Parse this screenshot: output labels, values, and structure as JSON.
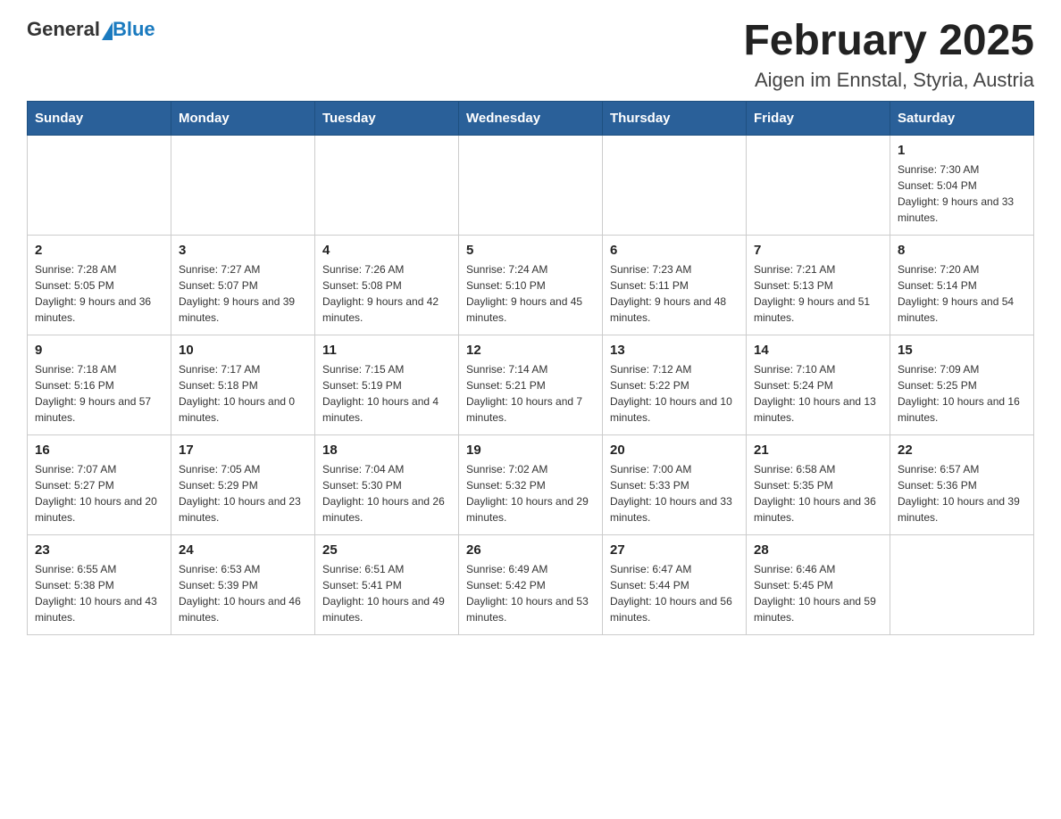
{
  "header": {
    "logo_general": "General",
    "logo_blue": "Blue",
    "title": "February 2025",
    "subtitle": "Aigen im Ennstal, Styria, Austria"
  },
  "days_of_week": [
    "Sunday",
    "Monday",
    "Tuesday",
    "Wednesday",
    "Thursday",
    "Friday",
    "Saturday"
  ],
  "weeks": [
    [
      {
        "day": "",
        "sunrise": "",
        "sunset": "",
        "daylight": ""
      },
      {
        "day": "",
        "sunrise": "",
        "sunset": "",
        "daylight": ""
      },
      {
        "day": "",
        "sunrise": "",
        "sunset": "",
        "daylight": ""
      },
      {
        "day": "",
        "sunrise": "",
        "sunset": "",
        "daylight": ""
      },
      {
        "day": "",
        "sunrise": "",
        "sunset": "",
        "daylight": ""
      },
      {
        "day": "",
        "sunrise": "",
        "sunset": "",
        "daylight": ""
      },
      {
        "day": "1",
        "sunrise": "Sunrise: 7:30 AM",
        "sunset": "Sunset: 5:04 PM",
        "daylight": "Daylight: 9 hours and 33 minutes."
      }
    ],
    [
      {
        "day": "2",
        "sunrise": "Sunrise: 7:28 AM",
        "sunset": "Sunset: 5:05 PM",
        "daylight": "Daylight: 9 hours and 36 minutes."
      },
      {
        "day": "3",
        "sunrise": "Sunrise: 7:27 AM",
        "sunset": "Sunset: 5:07 PM",
        "daylight": "Daylight: 9 hours and 39 minutes."
      },
      {
        "day": "4",
        "sunrise": "Sunrise: 7:26 AM",
        "sunset": "Sunset: 5:08 PM",
        "daylight": "Daylight: 9 hours and 42 minutes."
      },
      {
        "day": "5",
        "sunrise": "Sunrise: 7:24 AM",
        "sunset": "Sunset: 5:10 PM",
        "daylight": "Daylight: 9 hours and 45 minutes."
      },
      {
        "day": "6",
        "sunrise": "Sunrise: 7:23 AM",
        "sunset": "Sunset: 5:11 PM",
        "daylight": "Daylight: 9 hours and 48 minutes."
      },
      {
        "day": "7",
        "sunrise": "Sunrise: 7:21 AM",
        "sunset": "Sunset: 5:13 PM",
        "daylight": "Daylight: 9 hours and 51 minutes."
      },
      {
        "day": "8",
        "sunrise": "Sunrise: 7:20 AM",
        "sunset": "Sunset: 5:14 PM",
        "daylight": "Daylight: 9 hours and 54 minutes."
      }
    ],
    [
      {
        "day": "9",
        "sunrise": "Sunrise: 7:18 AM",
        "sunset": "Sunset: 5:16 PM",
        "daylight": "Daylight: 9 hours and 57 minutes."
      },
      {
        "day": "10",
        "sunrise": "Sunrise: 7:17 AM",
        "sunset": "Sunset: 5:18 PM",
        "daylight": "Daylight: 10 hours and 0 minutes."
      },
      {
        "day": "11",
        "sunrise": "Sunrise: 7:15 AM",
        "sunset": "Sunset: 5:19 PM",
        "daylight": "Daylight: 10 hours and 4 minutes."
      },
      {
        "day": "12",
        "sunrise": "Sunrise: 7:14 AM",
        "sunset": "Sunset: 5:21 PM",
        "daylight": "Daylight: 10 hours and 7 minutes."
      },
      {
        "day": "13",
        "sunrise": "Sunrise: 7:12 AM",
        "sunset": "Sunset: 5:22 PM",
        "daylight": "Daylight: 10 hours and 10 minutes."
      },
      {
        "day": "14",
        "sunrise": "Sunrise: 7:10 AM",
        "sunset": "Sunset: 5:24 PM",
        "daylight": "Daylight: 10 hours and 13 minutes."
      },
      {
        "day": "15",
        "sunrise": "Sunrise: 7:09 AM",
        "sunset": "Sunset: 5:25 PM",
        "daylight": "Daylight: 10 hours and 16 minutes."
      }
    ],
    [
      {
        "day": "16",
        "sunrise": "Sunrise: 7:07 AM",
        "sunset": "Sunset: 5:27 PM",
        "daylight": "Daylight: 10 hours and 20 minutes."
      },
      {
        "day": "17",
        "sunrise": "Sunrise: 7:05 AM",
        "sunset": "Sunset: 5:29 PM",
        "daylight": "Daylight: 10 hours and 23 minutes."
      },
      {
        "day": "18",
        "sunrise": "Sunrise: 7:04 AM",
        "sunset": "Sunset: 5:30 PM",
        "daylight": "Daylight: 10 hours and 26 minutes."
      },
      {
        "day": "19",
        "sunrise": "Sunrise: 7:02 AM",
        "sunset": "Sunset: 5:32 PM",
        "daylight": "Daylight: 10 hours and 29 minutes."
      },
      {
        "day": "20",
        "sunrise": "Sunrise: 7:00 AM",
        "sunset": "Sunset: 5:33 PM",
        "daylight": "Daylight: 10 hours and 33 minutes."
      },
      {
        "day": "21",
        "sunrise": "Sunrise: 6:58 AM",
        "sunset": "Sunset: 5:35 PM",
        "daylight": "Daylight: 10 hours and 36 minutes."
      },
      {
        "day": "22",
        "sunrise": "Sunrise: 6:57 AM",
        "sunset": "Sunset: 5:36 PM",
        "daylight": "Daylight: 10 hours and 39 minutes."
      }
    ],
    [
      {
        "day": "23",
        "sunrise": "Sunrise: 6:55 AM",
        "sunset": "Sunset: 5:38 PM",
        "daylight": "Daylight: 10 hours and 43 minutes."
      },
      {
        "day": "24",
        "sunrise": "Sunrise: 6:53 AM",
        "sunset": "Sunset: 5:39 PM",
        "daylight": "Daylight: 10 hours and 46 minutes."
      },
      {
        "day": "25",
        "sunrise": "Sunrise: 6:51 AM",
        "sunset": "Sunset: 5:41 PM",
        "daylight": "Daylight: 10 hours and 49 minutes."
      },
      {
        "day": "26",
        "sunrise": "Sunrise: 6:49 AM",
        "sunset": "Sunset: 5:42 PM",
        "daylight": "Daylight: 10 hours and 53 minutes."
      },
      {
        "day": "27",
        "sunrise": "Sunrise: 6:47 AM",
        "sunset": "Sunset: 5:44 PM",
        "daylight": "Daylight: 10 hours and 56 minutes."
      },
      {
        "day": "28",
        "sunrise": "Sunrise: 6:46 AM",
        "sunset": "Sunset: 5:45 PM",
        "daylight": "Daylight: 10 hours and 59 minutes."
      },
      {
        "day": "",
        "sunrise": "",
        "sunset": "",
        "daylight": ""
      }
    ]
  ]
}
